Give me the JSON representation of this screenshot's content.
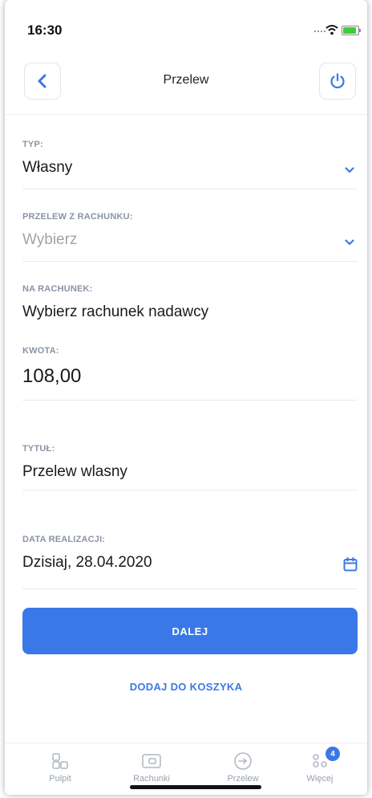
{
  "status_bar": {
    "time": "16:30"
  },
  "header": {
    "title": "Przelew"
  },
  "form": {
    "type": {
      "label": "TYP:",
      "value": "Własny"
    },
    "from_account": {
      "label": "PRZELEW Z RACHUNKU:",
      "value": "Wybierz"
    },
    "to_account": {
      "label": "NA RACHUNEK:",
      "value": "Wybierz rachunek nadawcy"
    },
    "amount": {
      "label": "KWOTA:",
      "value": "108,00"
    },
    "title": {
      "label": "TYTUŁ:",
      "value": "Przelew wlasny"
    },
    "date": {
      "label": "DATA REALIZACJI:",
      "value": "Dzisiaj, 28.04.2020"
    }
  },
  "actions": {
    "next_label": "DALEJ",
    "add_to_cart_label": "DODAJ DO KOSZYKA"
  },
  "tabbar": {
    "items": [
      {
        "label": "Pulpit",
        "icon": "dashboard-icon"
      },
      {
        "label": "Rachunki",
        "icon": "wallet-icon"
      },
      {
        "label": "Przelew",
        "icon": "transfer-arrow-icon"
      },
      {
        "label": "Więcej",
        "icon": "more-icon",
        "badge": "4"
      }
    ]
  },
  "colors": {
    "accent": "#3b78e7",
    "label": "#8a93a6",
    "placeholder": "#a3a3a3"
  }
}
